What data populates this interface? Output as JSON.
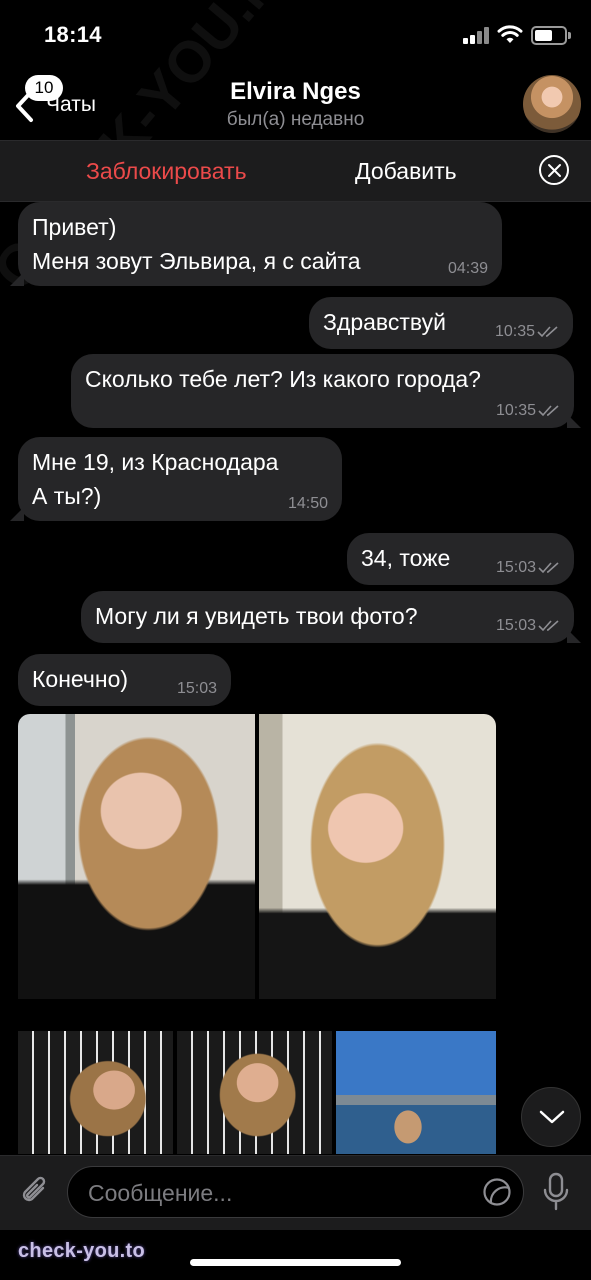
{
  "status_bar": {
    "time": "18:14"
  },
  "header": {
    "back_badge": "10",
    "back_label": "Чаты",
    "contact_name": "Elvira Nges",
    "contact_status": "был(а) недавно"
  },
  "action_bar": {
    "block_label": "Заблокировать",
    "add_label": "Добавить"
  },
  "messages": [
    {
      "direction": "incoming",
      "lines": [
        "Привет)",
        "Меня зовут Эльвира, я с сайта"
      ],
      "time": "04:39"
    },
    {
      "direction": "outgoing",
      "lines": [
        "Здравствуй"
      ],
      "time": "10:35",
      "read": true
    },
    {
      "direction": "outgoing",
      "lines": [
        "Сколько тебе лет? Из какого города?"
      ],
      "time": "10:35",
      "read": true
    },
    {
      "direction": "incoming",
      "lines": [
        "Мне 19, из Краснодара",
        "А ты?)"
      ],
      "time": "14:50"
    },
    {
      "direction": "outgoing",
      "lines": [
        "34, тоже"
      ],
      "time": "15:03",
      "read": true
    },
    {
      "direction": "outgoing",
      "lines": [
        "Могу ли я увидеть твои фото?"
      ],
      "time": "15:03",
      "read": true
    },
    {
      "direction": "incoming",
      "lines": [
        "Конечно)"
      ],
      "time": "15:03"
    }
  ],
  "input": {
    "placeholder": "Сообщение..."
  },
  "watermark": {
    "text": "check-you.to",
    "diagonal": "CHECK-YOU.ME"
  },
  "icons": [
    "back-chevron-icon",
    "close-icon",
    "attach-icon",
    "sticker-icon",
    "microphone-icon",
    "chevron-down-icon",
    "signal-icon",
    "wifi-icon",
    "battery-icon"
  ],
  "colors": {
    "background": "#000000",
    "bubble": "#262628",
    "block_red": "#eb4a4a",
    "secondary_text": "#8e8e93"
  }
}
